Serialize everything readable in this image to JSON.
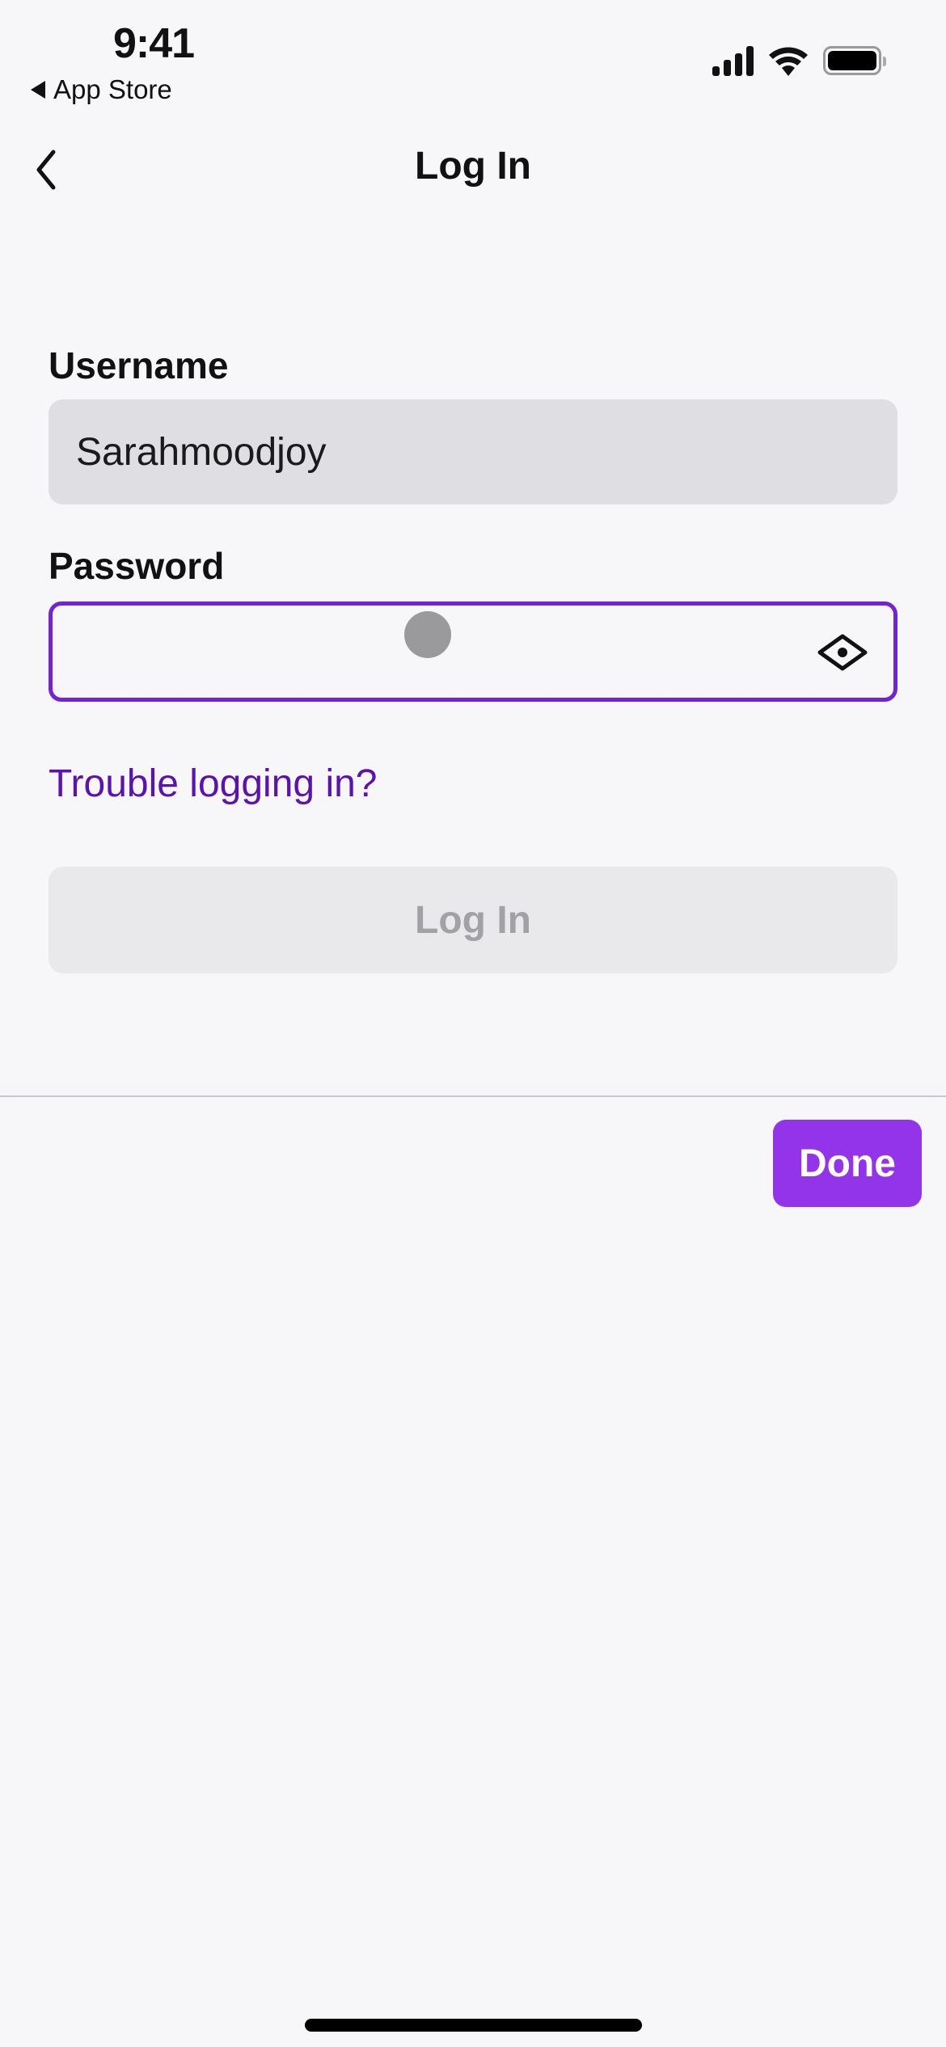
{
  "status_bar": {
    "time": "9:41",
    "back_app": "App Store",
    "icons": [
      "cellular-signal-icon",
      "wifi-icon",
      "battery-icon"
    ]
  },
  "nav": {
    "back_icon": "chevron-left-icon",
    "title": "Log In"
  },
  "form": {
    "username": {
      "label": "Username",
      "value": "Sarahmoodjoy"
    },
    "password": {
      "label": "Password",
      "value": "",
      "focused": true,
      "toggle_icon": "eye-icon"
    },
    "trouble_link": "Trouble logging in?",
    "login_button": {
      "label": "Log In",
      "enabled": false
    }
  },
  "keyboard_toolbar": {
    "done_label": "Done"
  },
  "colors": {
    "accent": "#9333ea",
    "focus_border": "#7422d6",
    "link": "#5a12b0",
    "background": "#f7f7fa",
    "input_bg": "#dfdfe3",
    "disabled_button_bg": "#e9e9ec",
    "disabled_button_text": "#a2a2a6"
  }
}
